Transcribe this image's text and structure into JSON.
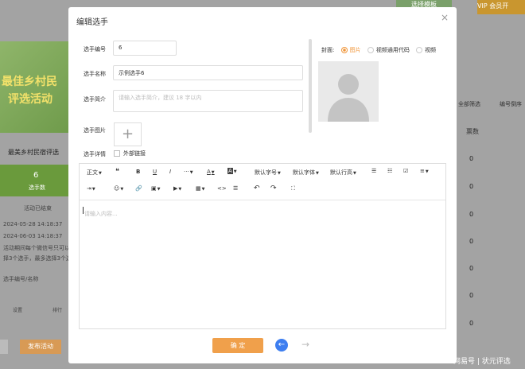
{
  "modal": {
    "title": "编辑选手",
    "close": "×"
  },
  "form": {
    "number_label": "选手编号",
    "number_value": "6",
    "name_label": "选手名称",
    "name_value": "示例选手6",
    "intro_label": "选手简介",
    "intro_placeholder": "请输入选手简介，建议 18 字以内",
    "image_label": "选手图片",
    "upload_plus": "+",
    "detail_label": "选手详情",
    "external_link": "外部链接"
  },
  "cover": {
    "label": "封面:",
    "options": [
      "图片",
      "视频通用代码",
      "视频"
    ],
    "selected": "图片",
    "accent": "#f0963a"
  },
  "toolbar": {
    "row1": [
      "正文",
      "❝",
      "B",
      "U",
      "I",
      "···",
      "A",
      "A",
      "默认字号",
      "默认字体",
      "默认行高",
      "☰",
      "☷",
      "☑",
      "≡"
    ],
    "row2": [
      "⇥",
      "☺",
      "🔗",
      "▣",
      "▶",
      "▦",
      "<>",
      "☰",
      "↶",
      "↷",
      "⛶"
    ]
  },
  "editor": {
    "placeholder": "请输入内容..."
  },
  "actions": {
    "ok_label": "确 定",
    "prev": "←",
    "next": "→"
  },
  "background": {
    "banner_line1": "最佳乡村民",
    "banner_line2": "评选活动",
    "event_title": "最美乡村民宿评选",
    "stat_count": "6",
    "stat_label": "选手数",
    "status": "活动已结束",
    "start_time": "2024-05-28 14:18:37",
    "end_time": "2024-06-03 14:18:37",
    "rule_line1": "活动期间每个微信号只可以",
    "rule_line2": "择3个选手，最多选择3个选",
    "search_label": "选手编号/名称",
    "tool_1": "设置",
    "tool_2": "排行",
    "publish": "发布活动",
    "top_btn1": "选择模板",
    "top_btn2": "VIP 会员开",
    "filter1": "全部筛选",
    "filter2": "编号倒序",
    "votes_header": "票数",
    "vote_values": [
      "0",
      "0",
      "0",
      "0",
      "0",
      "0",
      "0"
    ],
    "footer": "网易号 | 状元评选"
  }
}
